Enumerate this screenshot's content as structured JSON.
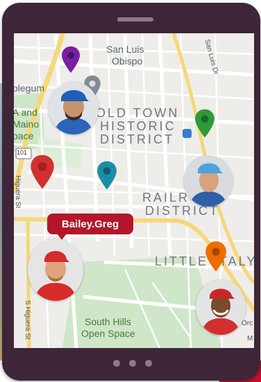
{
  "map": {
    "labels": {
      "san_luis_line1": "San Luis",
      "san_luis_line2": "Obispo",
      "old_town_line1": "OLD TOWN",
      "old_town_line2": "HISTORIC",
      "old_town_line3": "DISTRICT",
      "railroad_line1": "RAILR",
      "railroad_line2": "DISTRICT",
      "little_italy": "LITTLE ITALY",
      "south_hills_line1": "South Hills",
      "south_hills_line2": "Open Space",
      "left_partial_1": "plegum",
      "left_partial_2": "A and",
      "left_partial_3": "Maino",
      "left_partial_4": "pace",
      "highway_shield": "101",
      "street_higuera": "Higuera St",
      "street_s_higuera": "S Higuera St",
      "street_san_luis_dr": "San Luis Dr",
      "street_orc": "Orc",
      "street_m": "M"
    },
    "pins": [
      {
        "name": "purple-pin",
        "color": "#7b1fa2"
      },
      {
        "name": "gray-pin",
        "color": "#7f8c96"
      },
      {
        "name": "green-pin",
        "color": "#2e9a3a"
      },
      {
        "name": "red-pin",
        "color": "#d32f2f"
      },
      {
        "name": "teal-pin",
        "color": "#1b8ea6"
      },
      {
        "name": "orange-pin",
        "color": "#ef6c00"
      }
    ],
    "selected_worker": "Bailey.Greg"
  },
  "colors": {
    "tablet_frame": "#3e2638",
    "callout": "#b3162b",
    "highway": "#f6d77a",
    "park": "#c9e3c2"
  }
}
